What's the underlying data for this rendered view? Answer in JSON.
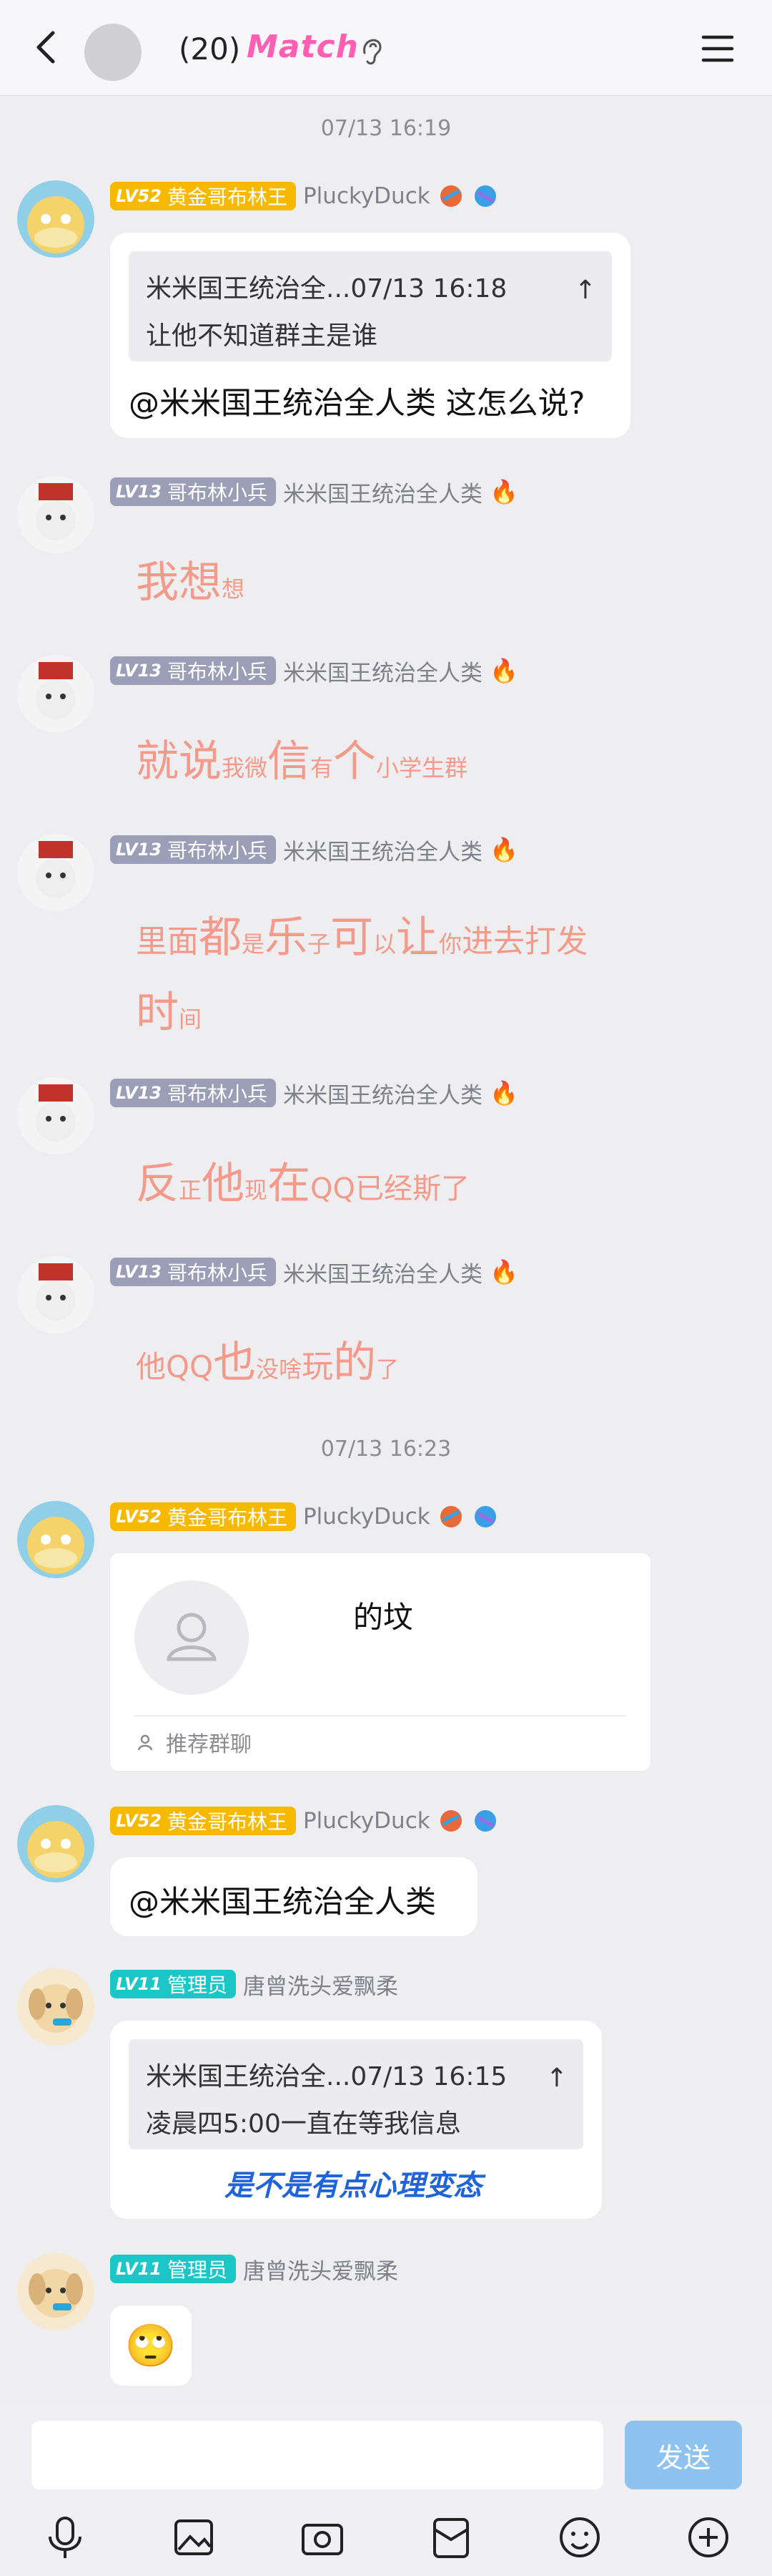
{
  "header": {
    "member_count": "(20)",
    "match_label": "Match",
    "icons": [
      "chevron-left-icon",
      "ear-icon",
      "hamburger-menu-icon"
    ]
  },
  "timestamps": [
    "07/13 16:19",
    "07/13 16:23"
  ],
  "messages": [
    {
      "level": "LV52",
      "title": "黄金哥布林王",
      "name": "PluckyDuck",
      "quote_header": "米米国王统治全...07/13 16:18",
      "quote_body": "让他不知道群主是谁",
      "text": "@米米国王统治全人类 这怎么说?"
    },
    {
      "level": "LV13",
      "title": "哥布林小兵",
      "name": "米米国王统治全人类",
      "sticker": [
        "我",
        "想",
        "想"
      ]
    },
    {
      "level": "LV13",
      "title": "哥布林小兵",
      "name": "米米国王统治全人类",
      "sticker": [
        "就",
        "说",
        "我",
        "微",
        "信",
        "有",
        "个",
        "小学",
        "生群"
      ]
    },
    {
      "level": "LV13",
      "title": "哥布林小兵",
      "name": "米米国王统治全人类",
      "sticker": [
        "里面",
        "都",
        "是",
        "乐",
        "子",
        "可",
        "以",
        "让",
        "你",
        "进去打",
        "发",
        "时",
        "间"
      ]
    },
    {
      "level": "LV13",
      "title": "哥布林小兵",
      "name": "米米国王统治全人类",
      "sticker": [
        "反",
        "正",
        "他",
        "现",
        "在",
        "QQ已经斯了"
      ]
    },
    {
      "level": "LV13",
      "title": "哥布林小兵",
      "name": "米米国王统治全人类",
      "sticker": [
        "他QQ",
        "也",
        "没啥",
        "玩",
        "的",
        "了"
      ]
    },
    {
      "level": "LV52",
      "title": "黄金哥布林王",
      "name": "PluckyDuck",
      "card_name": "的坟",
      "card_footer": "推荐群聊"
    },
    {
      "level": "LV52",
      "title": "黄金哥布林王",
      "name": "PluckyDuck",
      "text": "@米米国王统治全人类"
    },
    {
      "level": "LV11",
      "title": "管理员",
      "name": "唐曾洗头爱飘柔",
      "quote_header": "米米国王统治全...07/13 16:15",
      "quote_body": "凌晨四5:00一直在等我信息",
      "text": "是不是有点心理变态"
    },
    {
      "level": "LV11",
      "title": "管理员",
      "name": "唐曾洗头爱飘柔",
      "emoji": "🙄"
    }
  ],
  "input": {
    "placeholder": "",
    "send_label": "发送"
  },
  "toolbar": [
    "microphone-icon",
    "image-icon",
    "camera-icon",
    "red-packet-icon",
    "emoji-icon",
    "plus-icon"
  ],
  "colors": {
    "level_gold": "#f7b900",
    "level_gray": "#9a9fb7",
    "level_teal": "#1cc6c6",
    "sticker_text": "#f39a8a",
    "link_blue": "#1f64d8"
  }
}
